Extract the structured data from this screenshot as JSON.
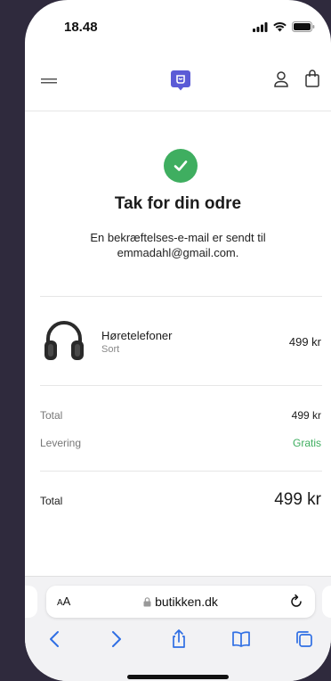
{
  "status_bar": {
    "time": "18.48"
  },
  "nav": {
    "menu_icon": "hamburger-icon",
    "logo_icon": "store-logo-icon",
    "user_icon": "user-icon",
    "bag_icon": "shopping-bag-icon",
    "brand_color": "#5b5bd6"
  },
  "confirmation": {
    "icon": "checkmark-circle-icon",
    "title": "Tak for din odre",
    "message": "En bekræftelses-e-mail er sendt til emmadahl@gmail.com.",
    "success_color": "#3fae60"
  },
  "order": {
    "items": [
      {
        "name": "Høretelefoner",
        "variant": "Sort",
        "price": "499 kr",
        "image": "headphones-image"
      }
    ],
    "summary": [
      {
        "label": "Total",
        "value": "499 kr"
      },
      {
        "label": "Levering",
        "value": "Gratis"
      }
    ],
    "grand_total": {
      "label": "Total",
      "value": "499 kr"
    }
  },
  "browser": {
    "text_size_label_large": "A",
    "text_size_label_small": "A",
    "url": "butikken.dk",
    "buttons": [
      "back-icon",
      "forward-icon",
      "share-icon",
      "bookmarks-icon",
      "tabs-icon"
    ]
  }
}
